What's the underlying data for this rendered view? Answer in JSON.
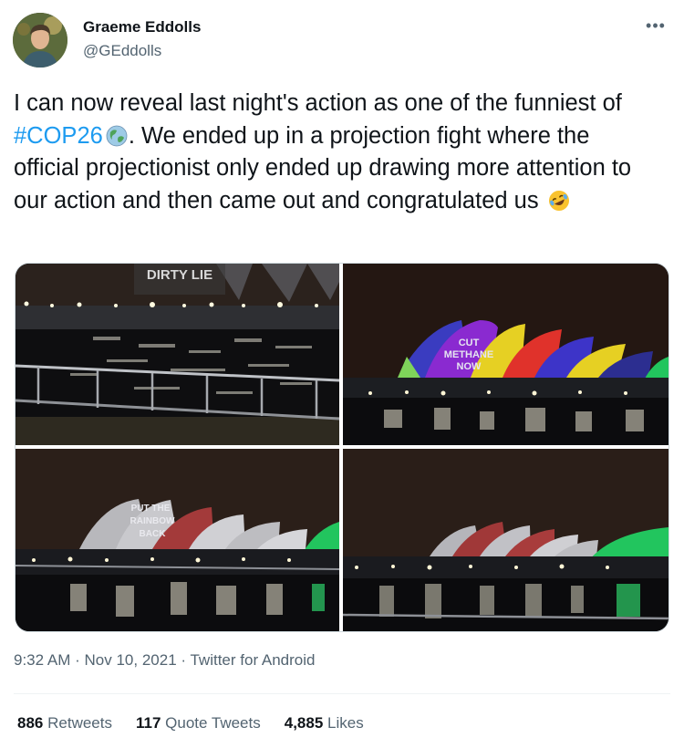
{
  "author": {
    "display_name": "Graeme Eddolls",
    "handle": "@GEddolls"
  },
  "more_icon": "•••",
  "tweet": {
    "text_before": "I can now reveal last night's action as one of the funniest of ",
    "hashtag": "#COP26",
    "text_after": ". We ended up in a projection fight where the official projectionist only ended up drawing more attention to our action and then came out and congratulated us",
    "hashtag_emoji": "earth-globe-icon",
    "end_emoji": "rolling-on-floor-laughing-icon"
  },
  "photos": {
    "photo1_projection": "DIRTY LIE",
    "photo2_projection_line1": "CUT",
    "photo2_projection_line2": "METHANE",
    "photo2_projection_line3": "NOW",
    "photo3_projection_line1": "PUT THE",
    "photo3_projection_line2": "RAINBOW",
    "photo3_projection_line3": "BACK"
  },
  "meta": {
    "time": "9:32 AM",
    "date": "Nov 10, 2021",
    "separator": "·",
    "source": "Twitter for Android"
  },
  "stats": {
    "retweets_count": "886",
    "retweets_label": "Retweets",
    "quotes_count": "117",
    "quotes_label": "Quote Tweets",
    "likes_count": "4,885",
    "likes_label": "Likes"
  },
  "colors": {
    "hashtag": "#1d9bf0",
    "secondary_text": "#536471",
    "primary_text": "#0f1419"
  }
}
